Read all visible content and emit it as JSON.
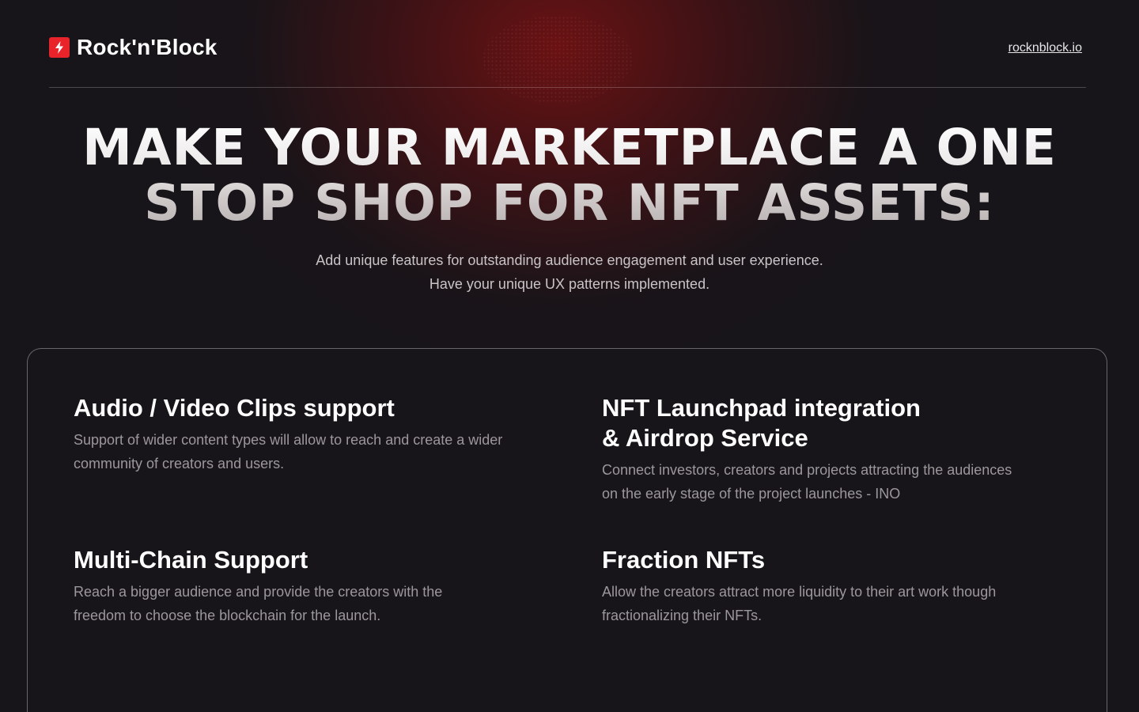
{
  "header": {
    "brand": "Rock'n'Block",
    "site_link": "rocknblock.io",
    "logo_icon": "lightning-bolt-icon",
    "accent_color": "#e8232a"
  },
  "hero": {
    "title_line1": "MAKE YOUR MARKETPLACE A ONE",
    "title_line2": "STOP SHOP FOR NFT ASSETS:",
    "subtitle_line1": "Add unique features for outstanding audience engagement and user experience.",
    "subtitle_line2": "Have your unique UX patterns implemented."
  },
  "features": [
    {
      "title": "Audio / Video Clips support",
      "description_line1": "Support of wider content types will allow to reach and create a wider",
      "description_line2": "community of creators and users."
    },
    {
      "title_line1": "NFT Launchpad integration",
      "title_line2": "& Airdrop Service",
      "description_line1": "Connect investors, creators and projects attracting the audiences",
      "description_line2": "on the early stage of the project launches - INO"
    },
    {
      "title": "Multi-Chain Support",
      "description_line1": "Reach a bigger audience and provide the creators with the",
      "description_line2": "freedom to choose the blockchain for the launch."
    },
    {
      "title": "Fraction NFTs",
      "description_line1": "Allow the creators attract more liquidity to their art work though",
      "description_line2": "fractionalizing their NFTs."
    }
  ]
}
